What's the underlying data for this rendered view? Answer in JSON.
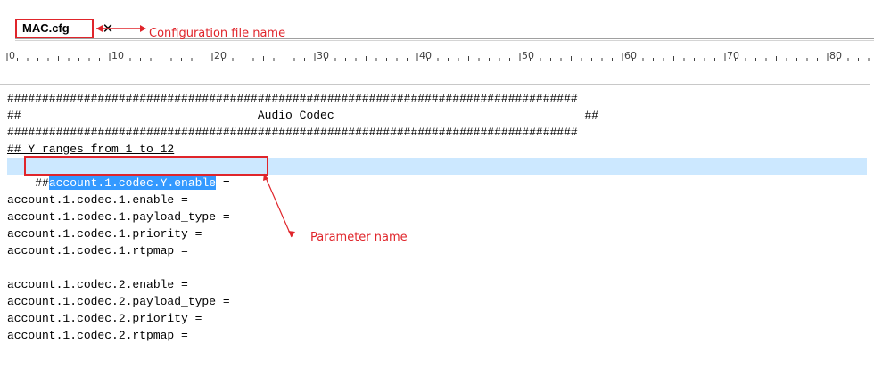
{
  "tab": {
    "label": "MAC.cfg",
    "close_glyph": "✕"
  },
  "annotations": {
    "config_file_name": "Configuration file name",
    "parameter_name": "Parameter name",
    "color": "#e0252b"
  },
  "ruler": {
    "labels": [
      "0",
      "10",
      "20",
      "30",
      "40",
      "50",
      "60",
      "70",
      "80"
    ]
  },
  "editor": {
    "lines": [
      "##################################################################################",
      "##                                  Audio Codec                                    ##",
      "##################################################################################",
      "## Y ranges from 1 to 12",
      "##account.1.codec.Y.enable =",
      "",
      "account.1.codec.1.enable =",
      "account.1.codec.1.payload_type =",
      "account.1.codec.1.priority =",
      "account.1.codec.1.rtpmap =",
      "",
      "account.1.codec.2.enable =",
      "account.1.codec.2.payload_type =",
      "account.1.codec.2.priority =",
      "account.1.codec.2.rtpmap ="
    ],
    "highlight_prefix": "##",
    "highlight_selected": "account.1.codec.Y.enable",
    "highlight_suffix": " ="
  }
}
